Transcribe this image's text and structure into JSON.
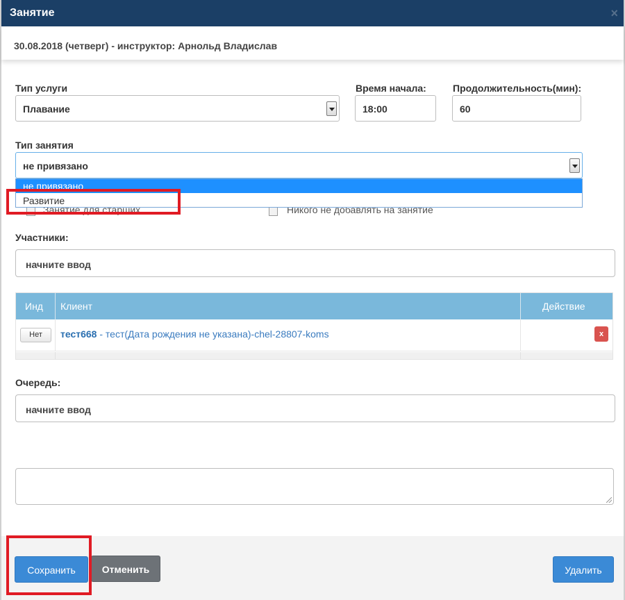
{
  "window": {
    "title": "Занятие",
    "close": "×"
  },
  "header": {
    "info": "30.08.2018 (четверг) - инструктор: Арнольд Владислав"
  },
  "service": {
    "label": "Тип услуги",
    "value": "Плавание"
  },
  "start_time": {
    "label": "Время начала:",
    "value": "18:00"
  },
  "duration": {
    "label": "Продолжительность(мин):",
    "value": "60"
  },
  "lesson_type": {
    "label": "Тип занятия",
    "value": "не привязано",
    "options": [
      "не привязано",
      "Развитие"
    ],
    "selected_index": 0
  },
  "checkboxes": {
    "left_label_partial": "Занятие для старших",
    "right_label": "Никого не добавлять на занятие"
  },
  "participants": {
    "label": "Участники:",
    "placeholder": "начните ввод"
  },
  "table": {
    "headers": {
      "ind": "Инд",
      "client": "Клиент",
      "action": "Действие"
    },
    "rows": [
      {
        "ind_button": "Нет",
        "client_name": "тест668",
        "client_detail": " - тест(Дата рождения не указана)-chel-28807-koms",
        "delete": "x"
      }
    ]
  },
  "queue": {
    "label": "Очередь:",
    "placeholder": "начните ввод"
  },
  "footer": {
    "save": "Сохранить",
    "cancel": "Отменить",
    "delete": "Удалить"
  },
  "colors": {
    "titlebar": "#1b3f66",
    "table_header": "#7ab8db",
    "primary": "#3b8ad6",
    "danger": "#d9534f",
    "highlight": "#e01b24",
    "selected_option": "#1e90ff"
  }
}
